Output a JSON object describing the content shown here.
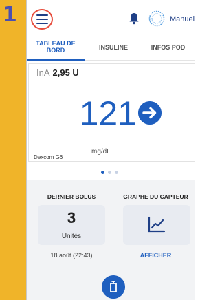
{
  "annotation": {
    "step": "1"
  },
  "header": {
    "menu_icon": "hamburger-menu-icon",
    "notification_icon": "bell-icon",
    "status_icon": "pod-status-icon",
    "mode_label": "Manuel"
  },
  "tabs": [
    {
      "label": "TABLEAU DE BORD",
      "active": true
    },
    {
      "label": "INSULINE",
      "active": false
    },
    {
      "label": "INFOS POD",
      "active": false
    }
  ],
  "glucose_card": {
    "iob_label": "InA",
    "iob_value": "2,95 U",
    "glucose_value": "121",
    "trend_icon": "arrow-right-icon",
    "unit": "mg/dL",
    "sensor": "Dexcom G6"
  },
  "pager": {
    "pages": 3,
    "active_index": 0
  },
  "bolus": {
    "title": "DERNIER BOLUS",
    "value": "3",
    "unit": "Unités",
    "date": "18 août (22:43)"
  },
  "sensor_graph": {
    "title": "GRAPHE DU CAPTEUR",
    "icon": "line-chart-icon",
    "link": "AFFICHER"
  },
  "fab": {
    "icon": "bolus-pod-icon"
  },
  "colors": {
    "accent": "#1f5fbf",
    "highlight_ring": "#e74c3c",
    "annotation_bar": "#f0b429",
    "step_number": "#4a4fb0"
  }
}
